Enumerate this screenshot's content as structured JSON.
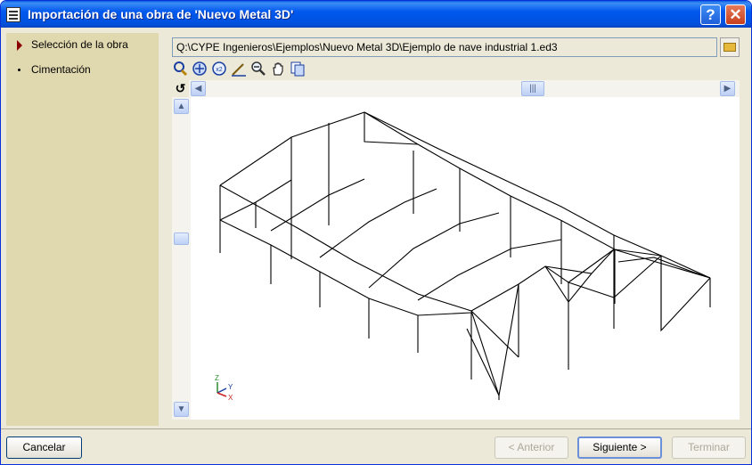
{
  "window": {
    "title": "Importación de una obra de 'Nuevo Metal 3D'",
    "help_label": "?",
    "close_label": "✕"
  },
  "steps": [
    {
      "label": "Selección de la obra",
      "active": true
    },
    {
      "label": "Cimentación",
      "active": false
    }
  ],
  "file": {
    "path": "Q:\\CYPE Ingenieros\\Ejemplos\\Nuevo Metal 3D\\Ejemplo de nave industrial 1.ed3"
  },
  "toolbar": {
    "icons": [
      "rotate-view-icon",
      "zoom-all-icon",
      "zoom-x2-icon",
      "zoom-window-icon",
      "zoom-out-icon",
      "pan-hand-icon",
      "copy-view-icon"
    ],
    "zoom_x2_label": "x2"
  },
  "viewport": {
    "rotate_label": "↺",
    "axes": {
      "z": "Z",
      "y": "Y",
      "x": "X"
    }
  },
  "buttons": {
    "cancel": "Cancelar",
    "previous": "< Anterior",
    "next": "Siguiente >",
    "finish": "Terminar"
  }
}
